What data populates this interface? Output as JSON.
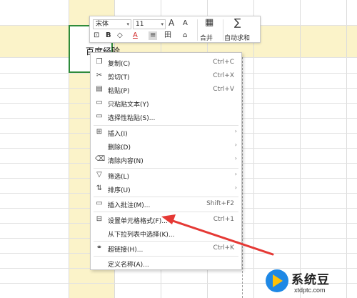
{
  "cell": {
    "text": "百度经验"
  },
  "toolbar": {
    "font_name": "宋体",
    "font_size": "11",
    "increase_font": "A",
    "decrease_font": "A",
    "format_painter": "⊡",
    "bold": "B",
    "fill_color": "◇",
    "font_color": "A",
    "align_center": "≡",
    "borders": "田",
    "merge_label": "合并",
    "autosum_label": "自动求和",
    "autosum_symbol": "∑"
  },
  "menu": {
    "items": [
      {
        "label": "复制(C)",
        "shortcut": "Ctrl+C",
        "icon": "copy-icon",
        "glyph": "❐"
      },
      {
        "label": "剪切(T)",
        "shortcut": "Ctrl+X",
        "icon": "scissors-icon",
        "glyph": "✂"
      },
      {
        "label": "粘贴(P)",
        "shortcut": "Ctrl+V",
        "icon": "clipboard-icon",
        "glyph": "▤"
      },
      {
        "label": "只粘贴文本(Y)",
        "shortcut": "",
        "icon": "paste-text-icon",
        "glyph": "▭"
      },
      {
        "label": "选择性粘贴(S)...",
        "shortcut": "",
        "icon": "paste-special-icon",
        "glyph": "▭"
      },
      {
        "label": "插入(I)",
        "shortcut": "",
        "icon": "insert-icon",
        "glyph": "⊞"
      },
      {
        "label": "删除(D)",
        "shortcut": "",
        "icon": "",
        "glyph": ""
      },
      {
        "label": "清除内容(N)",
        "shortcut": "",
        "icon": "eraser-icon",
        "glyph": "⌫"
      },
      {
        "label": "筛选(L)",
        "shortcut": "",
        "icon": "filter-icon",
        "glyph": "▽"
      },
      {
        "label": "排序(U)",
        "shortcut": "",
        "icon": "sort-icon",
        "glyph": "⇅"
      },
      {
        "label": "插入批注(M)...",
        "shortcut": "Shift+F2",
        "icon": "comment-icon",
        "glyph": "▭"
      },
      {
        "label": "设置单元格格式(F)...",
        "shortcut": "Ctrl+1",
        "icon": "format-cells-icon",
        "glyph": "⊟"
      },
      {
        "label": "从下拉列表中选择(K)...",
        "shortcut": "",
        "icon": "",
        "glyph": ""
      },
      {
        "label": "超链接(H)...",
        "shortcut": "Ctrl+K",
        "icon": "link-icon",
        "glyph": "⚭"
      },
      {
        "label": "定义名称(A)...",
        "shortcut": "",
        "icon": "",
        "glyph": ""
      }
    ],
    "submenu_arrow": "›"
  },
  "watermark": {
    "title": "系统豆",
    "url": "xtdptc.com"
  },
  "colors": {
    "selection_border": "#2e8b3a",
    "highlight": "#fbf3c9",
    "arrow": "#e53935"
  }
}
